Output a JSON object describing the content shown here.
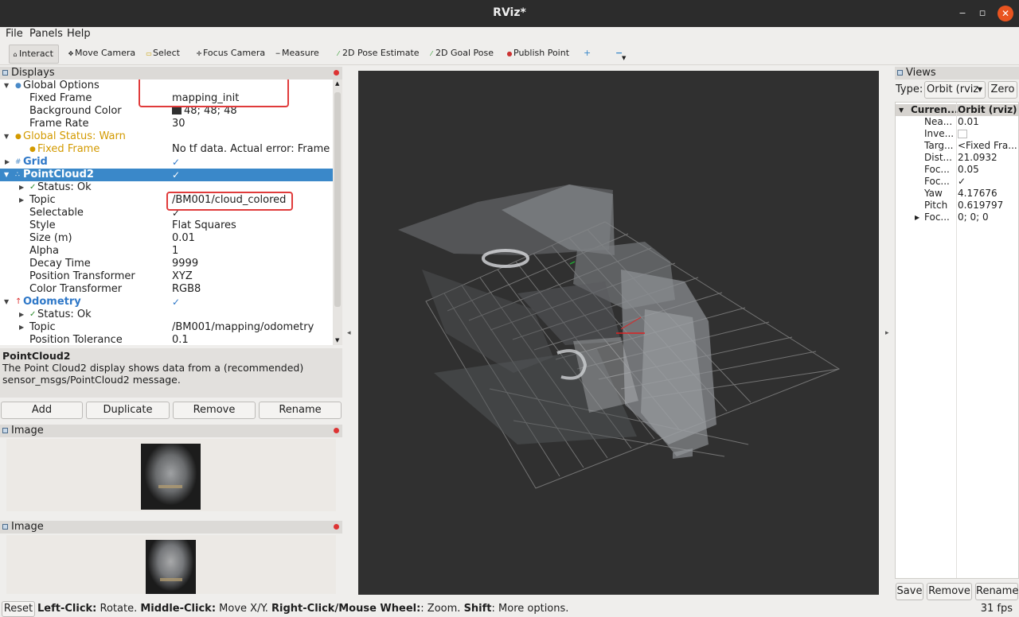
{
  "window": {
    "title": "RViz*",
    "min": "‒",
    "max": "▫",
    "close": "✕"
  },
  "menu": [
    "File",
    "Panels",
    "Help"
  ],
  "toolbar": {
    "interact": "Interact",
    "move_camera": "Move Camera",
    "select": "Select",
    "focus_camera": "Focus Camera",
    "measure": "Measure",
    "pose_estimate": "2D Pose Estimate",
    "goal_pose": "2D Goal Pose",
    "publish_point": "Publish Point",
    "plus": "+",
    "minus": "−"
  },
  "displays": {
    "title": "Displays",
    "global_options": "Global Options",
    "fixed_frame_label": "Fixed Frame",
    "fixed_frame": "mapping_init",
    "background_color_label": "Background Color",
    "background_color": "48; 48; 48",
    "frame_rate_label": "Frame Rate",
    "frame_rate": "30",
    "global_status": "Global Status: Warn",
    "fixed_frame_status_label": "Fixed Frame",
    "fixed_frame_status": "No tf data.  Actual error: Frame [...",
    "grid": "Grid",
    "pointcloud2": "PointCloud2",
    "pc_status": "Status: Ok",
    "topic_label": "Topic",
    "pc_topic": "/BM001/cloud_colored",
    "selectable_label": "Selectable",
    "style_label": "Style",
    "style": "Flat Squares",
    "size_label": "Size (m)",
    "size": "0.01",
    "alpha_label": "Alpha",
    "alpha": "1",
    "decay_label": "Decay Time",
    "decay": "9999",
    "pos_tf_label": "Position Transformer",
    "pos_tf": "XYZ",
    "color_tf_label": "Color Transformer",
    "color_tf": "RGB8",
    "odometry": "Odometry",
    "odom_status": "Status: Ok",
    "odom_topic": "/BM001/mapping/odometry",
    "pos_tol_label": "Position Tolerance",
    "pos_tol": "0.1",
    "check": "✓"
  },
  "description": {
    "title": "PointCloud2",
    "text_line1": "The Point Cloud2 display shows data from a (recommended)",
    "text_line2": "sensor_msgs/PointCloud2 message."
  },
  "display_buttons": {
    "add": "Add",
    "duplicate": "Duplicate",
    "remove": "Remove",
    "rename": "Rename"
  },
  "image_panels": [
    {
      "title": "Image"
    },
    {
      "title": "Image"
    }
  ],
  "views": {
    "title": "Views",
    "type_label": "Type:",
    "type_value": "Orbit (rviz",
    "zero": "Zero",
    "col_current": "Curren...",
    "col_orbit": "Orbit (rviz)",
    "rows": [
      {
        "k": "Nea...",
        "v": "0.01"
      },
      {
        "k": "Inve...",
        "v": ""
      },
      {
        "k": "Targ...",
        "v": "<Fixed Fra..."
      },
      {
        "k": "Dist...",
        "v": "21.0932"
      },
      {
        "k": "Foc...",
        "v": "0.05"
      },
      {
        "k": "Foc...",
        "v": "✓"
      },
      {
        "k": "Yaw",
        "v": "4.17676"
      },
      {
        "k": "Pitch",
        "v": "0.619797"
      },
      {
        "k": "Foc...",
        "v": "0; 0; 0"
      }
    ],
    "save": "Save",
    "remove": "Remove",
    "rename": "Rename"
  },
  "status": {
    "reset": "Reset",
    "left_key": "Left-Click:",
    "left_val": " Rotate. ",
    "middle_key": "Middle-Click:",
    "middle_val": " Move X/Y. ",
    "right_key": "Right-Click/Mouse Wheel:",
    "right_val": ": Zoom. ",
    "shift_key": "Shift",
    "shift_val": ": More options.",
    "fps": "31 fps"
  },
  "colors": {
    "selection": "#3a88c9",
    "accent_blue": "#2f78c8",
    "warn": "#d39a00",
    "annotation_red": "#e03b3b",
    "viewport_bg": "#303030"
  }
}
